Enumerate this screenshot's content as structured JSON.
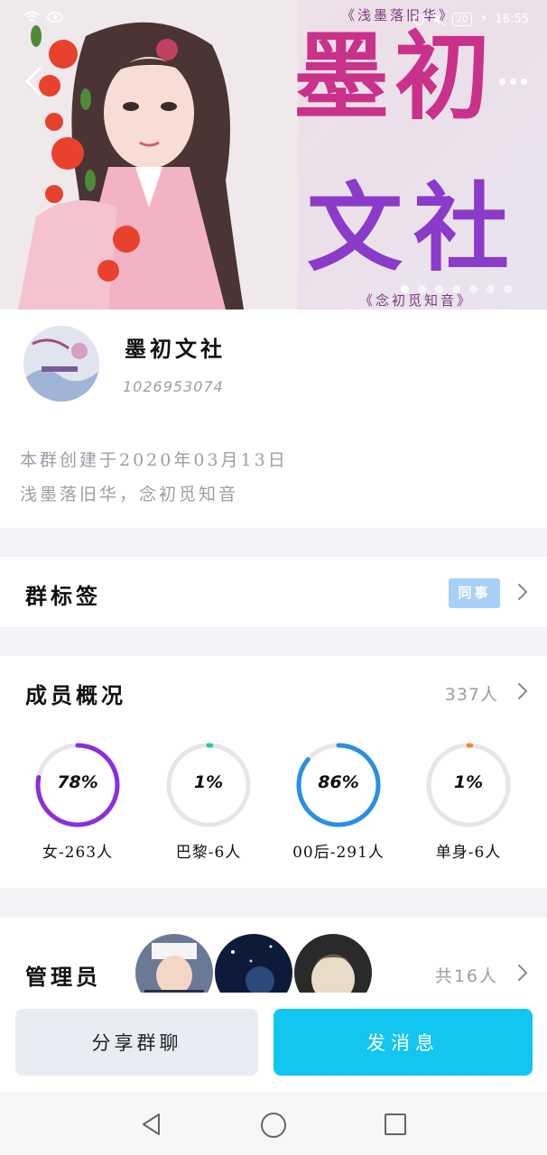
{
  "status_bar": {
    "time": "16:55",
    "battery": "20"
  },
  "banner": {
    "deco_top": "《浅墨落旧华》",
    "deco_bottom": "《念初觅知音》",
    "title_line1": "墨初",
    "title_line2": "文社",
    "dots_total": 7,
    "dots_active": 0
  },
  "group": {
    "name": "墨初文社",
    "id": "1026953074",
    "created": "本群创建于2020年03月13日",
    "motto": "浅墨落旧华，念初觅知音"
  },
  "tags": {
    "title": "群标签",
    "chip": "同事"
  },
  "members": {
    "title": "成员概况",
    "count": "337人",
    "stats": [
      {
        "pct_text": "78%",
        "value": 78,
        "label": "女-263人",
        "color": "#8a2ee0"
      },
      {
        "pct_text": "1%",
        "value": 1,
        "label": "巴黎-6人",
        "color": "#1fc8a0"
      },
      {
        "pct_text": "86%",
        "value": 86,
        "label": "00后-291人",
        "color": "#2a8ee6"
      },
      {
        "pct_text": "1%",
        "value": 1,
        "label": "单身-6人",
        "color": "#f08a2a"
      }
    ]
  },
  "admins": {
    "title": "管理员",
    "count": "共16人"
  },
  "actions": {
    "share": "分享群聊",
    "send": "发消息"
  },
  "colors": {
    "accent": "#12c6f0",
    "tag_chip": "#a8d0f7",
    "muted_text": "#9a9ea6"
  }
}
